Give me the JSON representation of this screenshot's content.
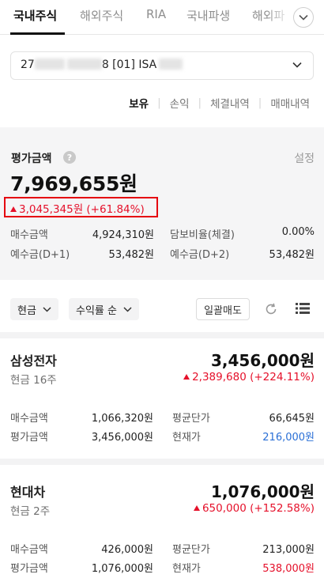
{
  "tabs": [
    {
      "label": "국내주식",
      "active": true
    },
    {
      "label": "해외주식",
      "active": false
    },
    {
      "label": "RIA",
      "active": false
    },
    {
      "label": "국내파생",
      "active": false
    },
    {
      "label": "해외파",
      "active": false
    }
  ],
  "account": {
    "prefix": "27",
    "middle": "8 [01] ISA",
    "masked": true
  },
  "subtabs": [
    "보유",
    "손익",
    "체결내역",
    "매매내역"
  ],
  "summary": {
    "label": "평가금액",
    "settings": "설정",
    "total": "7,969,655원",
    "gain": "3,045,345원 (+61.84%)",
    "buy_label": "매수금액",
    "buy_value": "4,924,310원",
    "collateral_label": "담보비율(체결)",
    "collateral_value": "0.00%",
    "deposit1_label": "예수금(D+1)",
    "deposit1_value": "53,482원",
    "deposit2_label": "예수금(D+2)",
    "deposit2_value": "53,482원"
  },
  "filters": {
    "type": "현금",
    "sort": "수익률 순",
    "bulk_sell": "일괄매도"
  },
  "holdings": [
    {
      "name": "삼성전자",
      "qty": "현금 16주",
      "value": "3,456,000원",
      "gain": "2,389,680 (+224.11%)",
      "buy_label": "매수금액",
      "buy_value": "1,066,320원",
      "eval_label": "평가금액",
      "eval_value": "3,456,000원",
      "avg_label": "평균단가",
      "avg_value": "66,645원",
      "price_label": "현재가",
      "price_value": "216,000원",
      "price_color": "#2a6fd6"
    },
    {
      "name": "현대차",
      "qty": "현금 2주",
      "value": "1,076,000원",
      "gain": "650,000 (+152.58%)",
      "buy_label": "매수금액",
      "buy_value": "426,000원",
      "eval_label": "평가금액",
      "eval_value": "1,076,000원",
      "avg_label": "평균단가",
      "avg_value": "213,000원",
      "price_label": "현재가",
      "price_value": "538,000원",
      "price_color": "#e5102a"
    }
  ],
  "colors": {
    "up": "#e5102a",
    "down": "#2a6fd6",
    "highlight_box": "#e5000f"
  },
  "icons": [
    "chevron-down-icon",
    "help-icon",
    "triangle-up-icon",
    "refresh-icon",
    "list-view-icon"
  ]
}
